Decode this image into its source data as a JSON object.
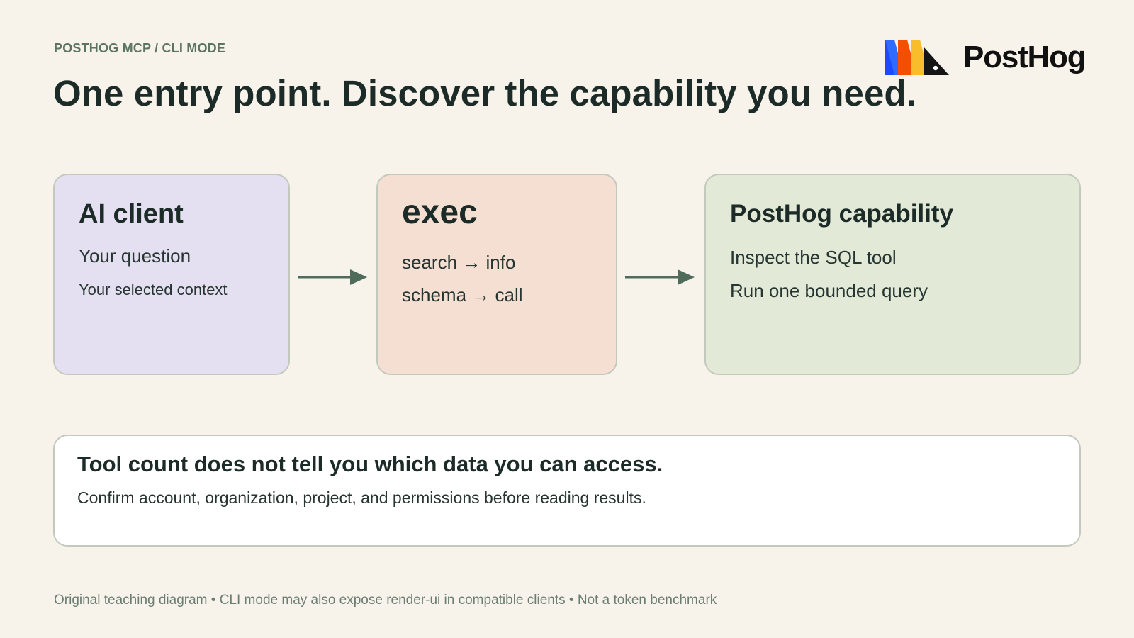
{
  "header": {
    "eyebrow": "POSTHOG MCP / CLI MODE",
    "title": "One entry point. Discover the capability you need.",
    "logo_text": "PostHog"
  },
  "flow": {
    "ai_client": {
      "title": "AI client",
      "lines": [
        "Your question",
        "Your selected context"
      ]
    },
    "exec": {
      "title": "exec",
      "lines": [
        "search → info",
        "schema → call"
      ]
    },
    "capability": {
      "title": "PostHog capability",
      "lines": [
        "Inspect the SQL tool",
        "Run one bounded query"
      ]
    }
  },
  "note": {
    "title": "Tool count does not tell you which data you can access.",
    "body": "Confirm account, organization, project, and permissions before reading results."
  },
  "footer": "Original teaching diagram • CLI mode may also expose render-ui in compatible clients • Not a token benchmark",
  "colors": {
    "background": "#f7f3eb",
    "ai_card": "#e5e0f1",
    "exec_card": "#f5dfd2",
    "capability_card": "#e2e9d7",
    "arrow": "#4f6b5a",
    "text": "#1c2b27"
  },
  "icons": {
    "logo": "posthog-logo-icon",
    "arrows": "arrow-right-icon"
  }
}
